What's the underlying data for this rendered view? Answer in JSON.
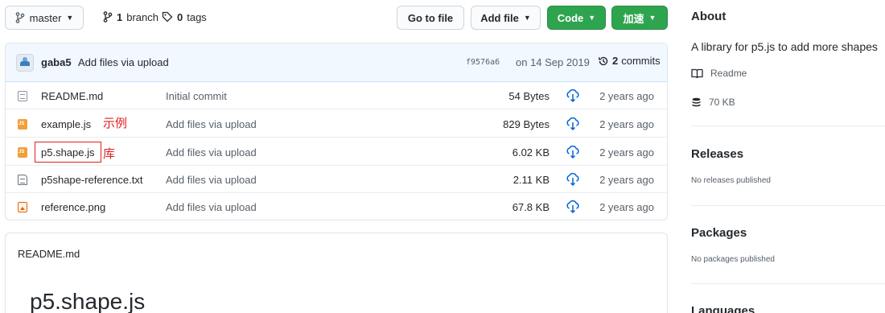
{
  "branch_bar": {
    "branch_name": "master",
    "branches_count": "1",
    "branches_word": "branch",
    "tags_count": "0",
    "tags_word": "tags",
    "goto_file": "Go to file",
    "add_file": "Add file",
    "code": "Code",
    "accelerate": "加速"
  },
  "commit": {
    "user": "gaba5",
    "message": "Add files via upload",
    "sha": "f9576a6",
    "date": "on 14 Sep 2019",
    "count": "2",
    "count_word": "commits"
  },
  "files": [
    {
      "name": "README.md",
      "icon": "markdown-file-icon",
      "message": "Initial commit",
      "size": "54 Bytes",
      "age": "2 years ago"
    },
    {
      "name": "example.js",
      "icon": "js-file-icon",
      "message": "Add files via upload",
      "size": "829 Bytes",
      "age": "2 years ago"
    },
    {
      "name": "p5.shape.js",
      "icon": "js-file-icon",
      "message": "Add files via upload",
      "size": "6.02 KB",
      "age": "2 years ago"
    },
    {
      "name": "p5shape-reference.txt",
      "icon": "text-file-icon",
      "message": "Add files via upload",
      "size": "2.11 KB",
      "age": "2 years ago"
    },
    {
      "name": "reference.png",
      "icon": "image-file-icon",
      "message": "Add files via upload",
      "size": "67.8 KB",
      "age": "2 years ago"
    }
  ],
  "annotations": {
    "example_note": "示例",
    "lib_note": "库",
    "color": "#e02020"
  },
  "readme": {
    "label": "README.md",
    "heading": "p5.shape.js"
  },
  "sidebar": {
    "about_title": "About",
    "about_desc": "A library for p5.js to add more shapes",
    "readme_link": "Readme",
    "size": "70 KB",
    "releases_title": "Releases",
    "releases_note": "No releases published",
    "packages_title": "Packages",
    "packages_note": "No packages published",
    "languages_title": "Languages"
  },
  "colors": {
    "accent_green": "#2ea44f",
    "link_blue": "#0366d6",
    "commit_bar_bg": "#f1f8ff"
  }
}
